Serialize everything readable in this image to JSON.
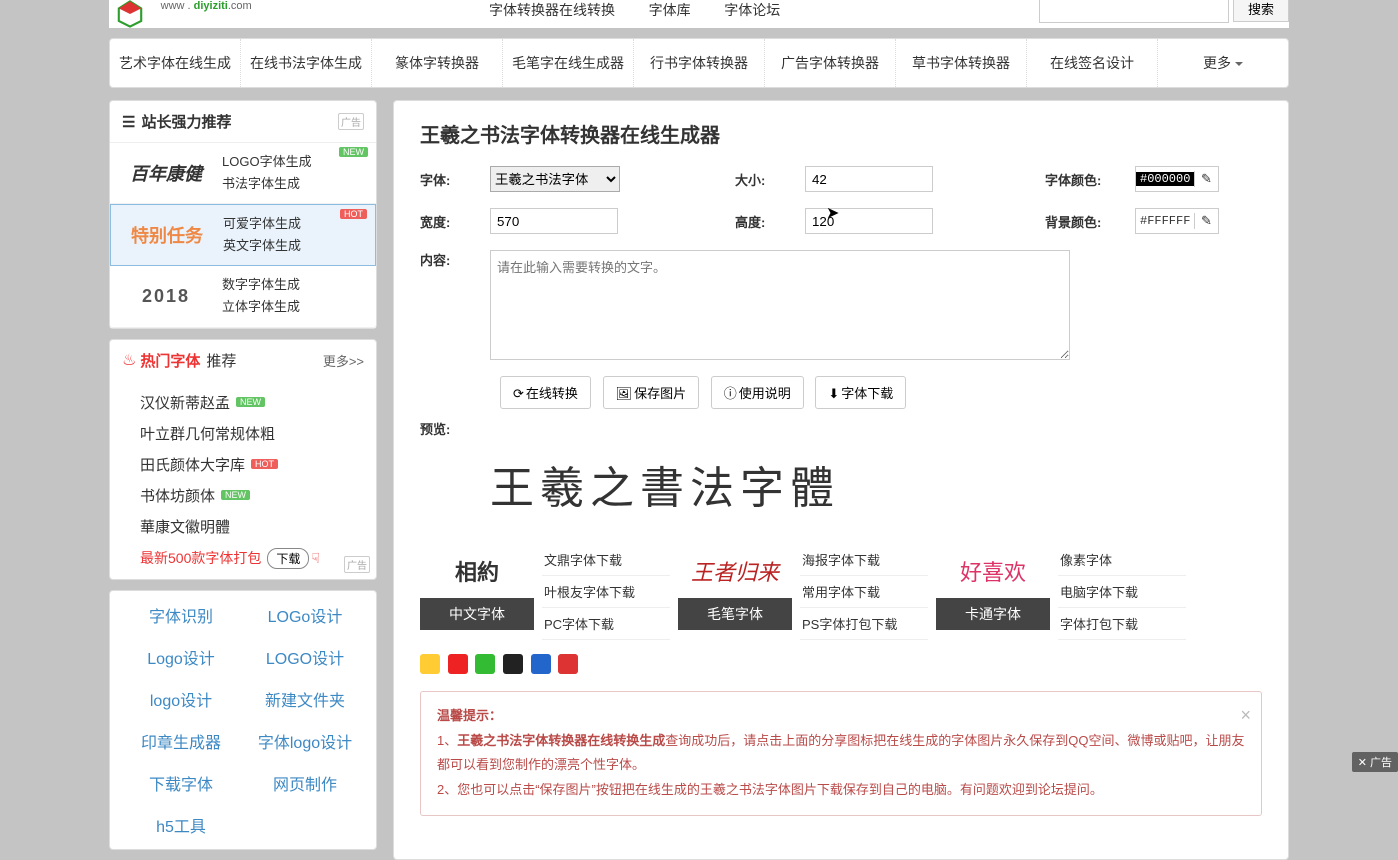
{
  "site_url_label": "www . diyiziti.com",
  "topnav": [
    "字体转换器在线转换",
    "字体库",
    "字体论坛"
  ],
  "search": {
    "btn": "搜索"
  },
  "mainnav": [
    "艺术字体在线生成",
    "在线书法字体生成",
    "篆体字转换器",
    "毛笔字在线生成器",
    "行书字体转换器",
    "广告字体转换器",
    "草书字体转换器",
    "在线签名设计",
    "更多"
  ],
  "sidebar": {
    "rec_title": "站长强力推荐",
    "ad_label": "广告",
    "recs": [
      {
        "thumb": "百年康健",
        "l1": "LOGO字体生成",
        "l2": "书法字体生成",
        "tag": "NEW"
      },
      {
        "thumb": "特别任务",
        "l1": "可爱字体生成",
        "l2": "英文字体生成",
        "tag": "HOT",
        "selected": true
      },
      {
        "thumb": "2018",
        "l1": "数字字体生成",
        "l2": "立体字体生成",
        "tag": ""
      }
    ],
    "hot_title1": "热门字体",
    "hot_title2": "推荐",
    "hot_more": "更多>>",
    "hot_items": [
      {
        "t": "汉仪新蒂赵孟",
        "tag": "NEW"
      },
      {
        "t": "叶立群几何常规体粗",
        "tag": ""
      },
      {
        "t": "田氏颜体大字库",
        "tag": "HOT"
      },
      {
        "t": "书体坊颜体",
        "tag": "NEW"
      },
      {
        "t": "華康文徽明體",
        "tag": ""
      }
    ],
    "hot_download": "最新500款字体打包",
    "hot_download_btn": "下载",
    "links": [
      "字体识别",
      "LOGo设计",
      "Logo设计",
      "LOGO设计",
      "logo设计",
      "新建文件夹",
      "印章生成器",
      "字体logo设计",
      "下载字体",
      "网页制作",
      "h5工具"
    ]
  },
  "main": {
    "title": "王羲之书法字体转换器在线生成器",
    "labels": {
      "font": "字体:",
      "size": "大小:",
      "fontcolor": "字体颜色:",
      "width": "宽度:",
      "height": "高度:",
      "bgcolor": "背景颜色:",
      "content": "内容:",
      "preview": "预览:"
    },
    "fields": {
      "font_option": "王羲之书法字体",
      "size": "42",
      "fontcolor": "#000000",
      "width": "570",
      "height": "120",
      "bgcolor": "#FFFFFF",
      "content_placeholder": "请在此输入需要转换的文字。"
    },
    "buttons": {
      "convert": "在线转换",
      "save": "保存图片",
      "help": "使用说明",
      "download": "字体下载"
    },
    "preview_text": "王羲之書法字體",
    "cats": [
      {
        "thumb": "相約",
        "label": "中文字体",
        "links": [
          "文鼎字体下载",
          "叶根友字体下载",
          "PC字体下载"
        ]
      },
      {
        "thumb": "王者归来",
        "label": "毛笔字体",
        "links": [
          "海报字体下载",
          "常用字体下载",
          "PS字体打包下载"
        ]
      },
      {
        "thumb": "好喜欢",
        "label": "卡通字体",
        "links": [
          "像素字体",
          "电脑字体下载",
          "字体打包下载"
        ]
      }
    ],
    "tip_title": "温馨提示：",
    "tip_lines": [
      {
        "pre": "1、",
        "bold": "王羲之书法字体转换器在线转换生成",
        "rest": "查询成功后，请点击上面的分享图标把在线生成的字体图片永久保存到QQ空间、微博或贴吧，让朋友都可以看到您制作的漂亮个性字体。"
      },
      {
        "pre": "2、您也可以点击“保存图片”按钮把在线生成的王羲之书法字体图片下载保存到自己的电脑。有问题欢迎到论坛提问。",
        "bold": "",
        "rest": ""
      }
    ],
    "ad_float": "广告"
  }
}
